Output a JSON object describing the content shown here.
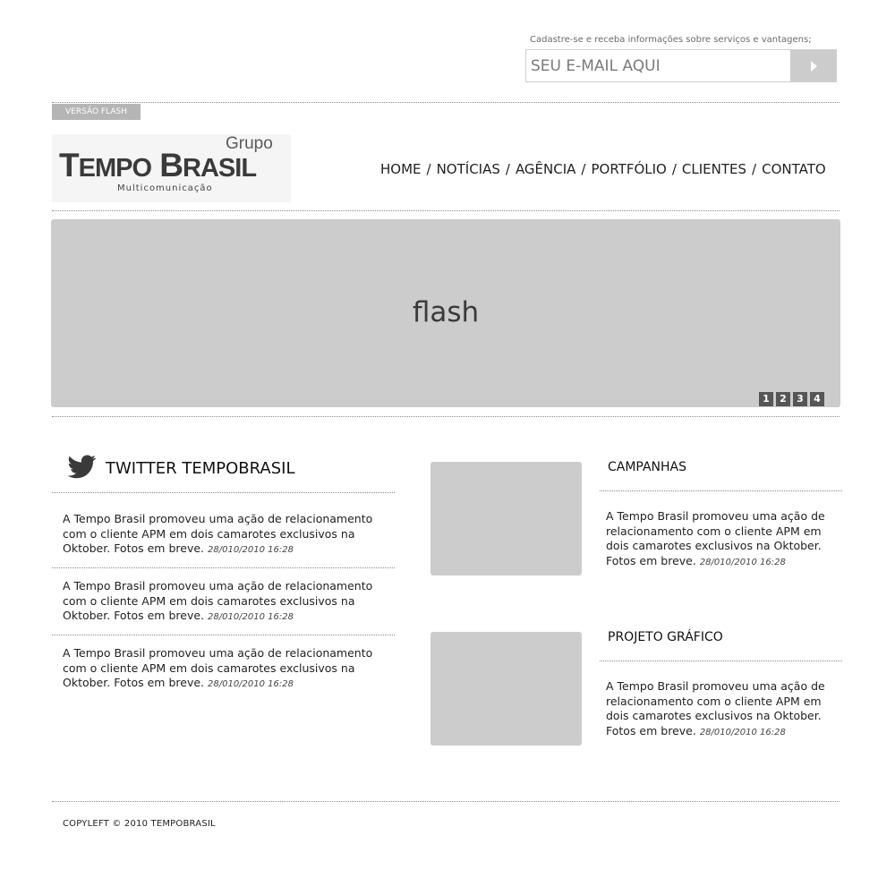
{
  "newsletter": {
    "prompt": "Cadastre-se e receba informações sobre serviços e vantagens;",
    "placeholder": "SEU E-MAIL AQUI",
    "submit_icon": "play-arrow-icon"
  },
  "version_flash_label": "VERSÃO FLASH",
  "logo": {
    "grupo": "Grupo",
    "main_t": "T",
    "main_1": "EMPO",
    "main_b": "B",
    "main_2": "RASIL",
    "sub": "Multicomunicação"
  },
  "nav": {
    "separator": "/",
    "items": [
      "HOME",
      "NOTÍCIAS",
      "AGÊNCIA",
      "PORTFÓLIO",
      "CLIENTES",
      "CONTATO"
    ]
  },
  "flash": {
    "label": "flash",
    "pages": [
      "1",
      "2",
      "3",
      "4"
    ]
  },
  "twitter": {
    "title": "TWITTER TEMPOBRASIL",
    "icon": "twitter-bird-icon",
    "tweets": [
      {
        "text": "A Tempo Brasil promoveu uma ação de relacionamento com o cliente APM em dois camarotes exclusivos na Oktober. Fotos em breve.",
        "date": "28/010/2010 16:28"
      },
      {
        "text": "A Tempo Brasil promoveu uma ação de relacionamento com o cliente APM em dois camarotes exclusivos na Oktober. Fotos em breve.",
        "date": "28/010/2010 16:28"
      },
      {
        "text": "A Tempo Brasil promoveu uma ação de relacionamento com o cliente APM em dois camarotes exclusivos na Oktober. Fotos em breve.",
        "date": "28/010/2010 16:28"
      }
    ]
  },
  "sections": [
    {
      "title": "CAMPANHAS",
      "text": " A Tempo Brasil promoveu uma ação de relacionamento com o cliente APM em dois camarotes exclusivos na  Oktober. Fotos em breve.",
      "date": "28/010/2010 16:28"
    },
    {
      "title": "PROJETO GRÁFICO",
      "text": " A Tempo Brasil promoveu uma ação de relacionamento com o cliente APM em dois camarotes exclusivos na  Oktober. Fotos em breve.",
      "date": "28/010/2010 16:28"
    }
  ],
  "footer": "COPYLEFT © 2010 TEMPOBRASIL",
  "colors": {
    "placeholder_gray": "#cccccc",
    "dark_pager": "#555555",
    "tag_gray": "#b5b5b5"
  }
}
